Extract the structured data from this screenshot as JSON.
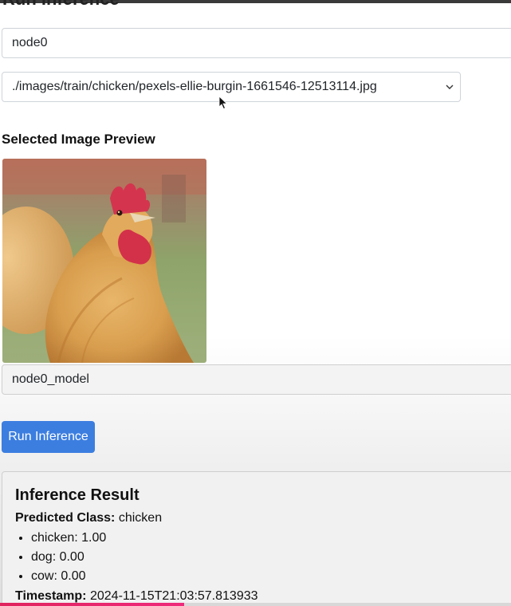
{
  "page": {
    "title": "Run Inference",
    "node_input_value": "node0",
    "image_select": {
      "selected": "./images/train/chicken/pexels-ellie-burgin-1661546-12513114.jpg"
    },
    "preview_heading": "Selected Image Preview",
    "model_input_value": "node0_model",
    "run_button_label": "Run Inference"
  },
  "result": {
    "title": "Inference Result",
    "predicted_label": "Predicted Class:",
    "predicted_value": "chicken",
    "probabilities": [
      {
        "text": "chicken: 1.00"
      },
      {
        "text": "dog: 0.00"
      },
      {
        "text": "cow: 0.00"
      }
    ],
    "timestamp_label": "Timestamp:",
    "timestamp_value": "2024-11-15T21:03:57.813933"
  },
  "video_progress": {
    "fraction": 0.36,
    "color": "#e0245e"
  },
  "colors": {
    "button": "#3c7ee0",
    "card_bg": "#f1f1f1"
  }
}
